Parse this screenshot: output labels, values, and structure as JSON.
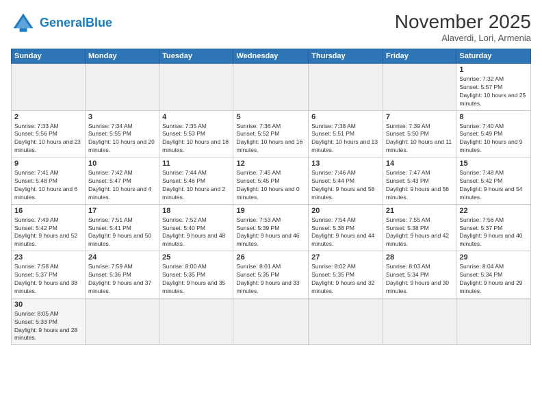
{
  "logo": {
    "general": "General",
    "blue": "Blue"
  },
  "header": {
    "month": "November 2025",
    "location": "Alaverdi, Lori, Armenia"
  },
  "weekdays": [
    "Sunday",
    "Monday",
    "Tuesday",
    "Wednesday",
    "Thursday",
    "Friday",
    "Saturday"
  ],
  "weeks": [
    [
      {
        "day": "",
        "info": ""
      },
      {
        "day": "",
        "info": ""
      },
      {
        "day": "",
        "info": ""
      },
      {
        "day": "",
        "info": ""
      },
      {
        "day": "",
        "info": ""
      },
      {
        "day": "",
        "info": ""
      },
      {
        "day": "1",
        "info": "Sunrise: 7:32 AM\nSunset: 5:57 PM\nDaylight: 10 hours and 25 minutes."
      }
    ],
    [
      {
        "day": "2",
        "info": "Sunrise: 7:33 AM\nSunset: 5:56 PM\nDaylight: 10 hours and 23 minutes."
      },
      {
        "day": "3",
        "info": "Sunrise: 7:34 AM\nSunset: 5:55 PM\nDaylight: 10 hours and 20 minutes."
      },
      {
        "day": "4",
        "info": "Sunrise: 7:35 AM\nSunset: 5:53 PM\nDaylight: 10 hours and 18 minutes."
      },
      {
        "day": "5",
        "info": "Sunrise: 7:36 AM\nSunset: 5:52 PM\nDaylight: 10 hours and 16 minutes."
      },
      {
        "day": "6",
        "info": "Sunrise: 7:38 AM\nSunset: 5:51 PM\nDaylight: 10 hours and 13 minutes."
      },
      {
        "day": "7",
        "info": "Sunrise: 7:39 AM\nSunset: 5:50 PM\nDaylight: 10 hours and 11 minutes."
      },
      {
        "day": "8",
        "info": "Sunrise: 7:40 AM\nSunset: 5:49 PM\nDaylight: 10 hours and 9 minutes."
      }
    ],
    [
      {
        "day": "9",
        "info": "Sunrise: 7:41 AM\nSunset: 5:48 PM\nDaylight: 10 hours and 6 minutes."
      },
      {
        "day": "10",
        "info": "Sunrise: 7:42 AM\nSunset: 5:47 PM\nDaylight: 10 hours and 4 minutes."
      },
      {
        "day": "11",
        "info": "Sunrise: 7:44 AM\nSunset: 5:46 PM\nDaylight: 10 hours and 2 minutes."
      },
      {
        "day": "12",
        "info": "Sunrise: 7:45 AM\nSunset: 5:45 PM\nDaylight: 10 hours and 0 minutes."
      },
      {
        "day": "13",
        "info": "Sunrise: 7:46 AM\nSunset: 5:44 PM\nDaylight: 9 hours and 58 minutes."
      },
      {
        "day": "14",
        "info": "Sunrise: 7:47 AM\nSunset: 5:43 PM\nDaylight: 9 hours and 56 minutes."
      },
      {
        "day": "15",
        "info": "Sunrise: 7:48 AM\nSunset: 5:42 PM\nDaylight: 9 hours and 54 minutes."
      }
    ],
    [
      {
        "day": "16",
        "info": "Sunrise: 7:49 AM\nSunset: 5:42 PM\nDaylight: 9 hours and 52 minutes."
      },
      {
        "day": "17",
        "info": "Sunrise: 7:51 AM\nSunset: 5:41 PM\nDaylight: 9 hours and 50 minutes."
      },
      {
        "day": "18",
        "info": "Sunrise: 7:52 AM\nSunset: 5:40 PM\nDaylight: 9 hours and 48 minutes."
      },
      {
        "day": "19",
        "info": "Sunrise: 7:53 AM\nSunset: 5:39 PM\nDaylight: 9 hours and 46 minutes."
      },
      {
        "day": "20",
        "info": "Sunrise: 7:54 AM\nSunset: 5:38 PM\nDaylight: 9 hours and 44 minutes."
      },
      {
        "day": "21",
        "info": "Sunrise: 7:55 AM\nSunset: 5:38 PM\nDaylight: 9 hours and 42 minutes."
      },
      {
        "day": "22",
        "info": "Sunrise: 7:56 AM\nSunset: 5:37 PM\nDaylight: 9 hours and 40 minutes."
      }
    ],
    [
      {
        "day": "23",
        "info": "Sunrise: 7:58 AM\nSunset: 5:37 PM\nDaylight: 9 hours and 38 minutes."
      },
      {
        "day": "24",
        "info": "Sunrise: 7:59 AM\nSunset: 5:36 PM\nDaylight: 9 hours and 37 minutes."
      },
      {
        "day": "25",
        "info": "Sunrise: 8:00 AM\nSunset: 5:35 PM\nDaylight: 9 hours and 35 minutes."
      },
      {
        "day": "26",
        "info": "Sunrise: 8:01 AM\nSunset: 5:35 PM\nDaylight: 9 hours and 33 minutes."
      },
      {
        "day": "27",
        "info": "Sunrise: 8:02 AM\nSunset: 5:35 PM\nDaylight: 9 hours and 32 minutes."
      },
      {
        "day": "28",
        "info": "Sunrise: 8:03 AM\nSunset: 5:34 PM\nDaylight: 9 hours and 30 minutes."
      },
      {
        "day": "29",
        "info": "Sunrise: 8:04 AM\nSunset: 5:34 PM\nDaylight: 9 hours and 29 minutes."
      }
    ],
    [
      {
        "day": "30",
        "info": "Sunrise: 8:05 AM\nSunset: 5:33 PM\nDaylight: 9 hours and 28 minutes."
      },
      {
        "day": "",
        "info": ""
      },
      {
        "day": "",
        "info": ""
      },
      {
        "day": "",
        "info": ""
      },
      {
        "day": "",
        "info": ""
      },
      {
        "day": "",
        "info": ""
      },
      {
        "day": "",
        "info": ""
      }
    ]
  ]
}
